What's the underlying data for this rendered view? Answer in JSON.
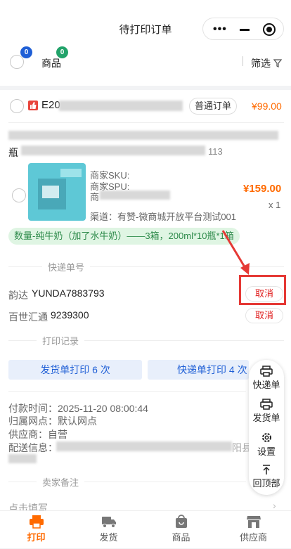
{
  "page": {
    "title": "待打印订单"
  },
  "capsule": {
    "more_glyph": "•••"
  },
  "filter_bar": {
    "badge_left": "0",
    "badge_right": "0",
    "goods_label": "商品",
    "filter_label": "筛选"
  },
  "order": {
    "order_prefix": "E20",
    "order_type": "普通订单",
    "order_total": "¥99.00",
    "address_partial": "瓶",
    "address_suffix": "113",
    "item": {
      "sku_label": "商家SKU:",
      "spu_label": "商家SPU:",
      "third_label": "商",
      "channel_label": "渠道：有赞-微商城开放平台测试001",
      "price": "¥159.00",
      "qty": "x 1"
    },
    "spec_tag": "数量-纯牛奶（加了水牛奶）——3箱，200ml*10瓶*1箱"
  },
  "express": {
    "section_title": "快递单号",
    "rows": [
      {
        "carrier": "韵达",
        "number": "YUNDA7883793",
        "action": "取消"
      },
      {
        "carrier": "百世汇通",
        "number": "9239300",
        "action": "取消"
      }
    ]
  },
  "print_record": {
    "section_title": "打印记录",
    "ship_label": "发货单打印 6 次",
    "express_label": "快递单打印 4 次"
  },
  "info": {
    "pay_time": "付款时间：2025-11-20 08:00:44",
    "outlet": "归属网点：默认网点",
    "supplier": "供应商：自营",
    "delivery": "配送信息：",
    "delivery_tail": "阳县"
  },
  "remark": {
    "section_title": "卖家备注",
    "placeholder": "点击填写"
  },
  "float_menu": {
    "items": [
      "快递单",
      "发货单",
      "设置",
      "回顶部"
    ]
  },
  "tabbar": {
    "items": [
      "打印",
      "发货",
      "商品",
      "供应商"
    ],
    "active_color": "#ff6a00",
    "inactive_color": "#555555"
  }
}
